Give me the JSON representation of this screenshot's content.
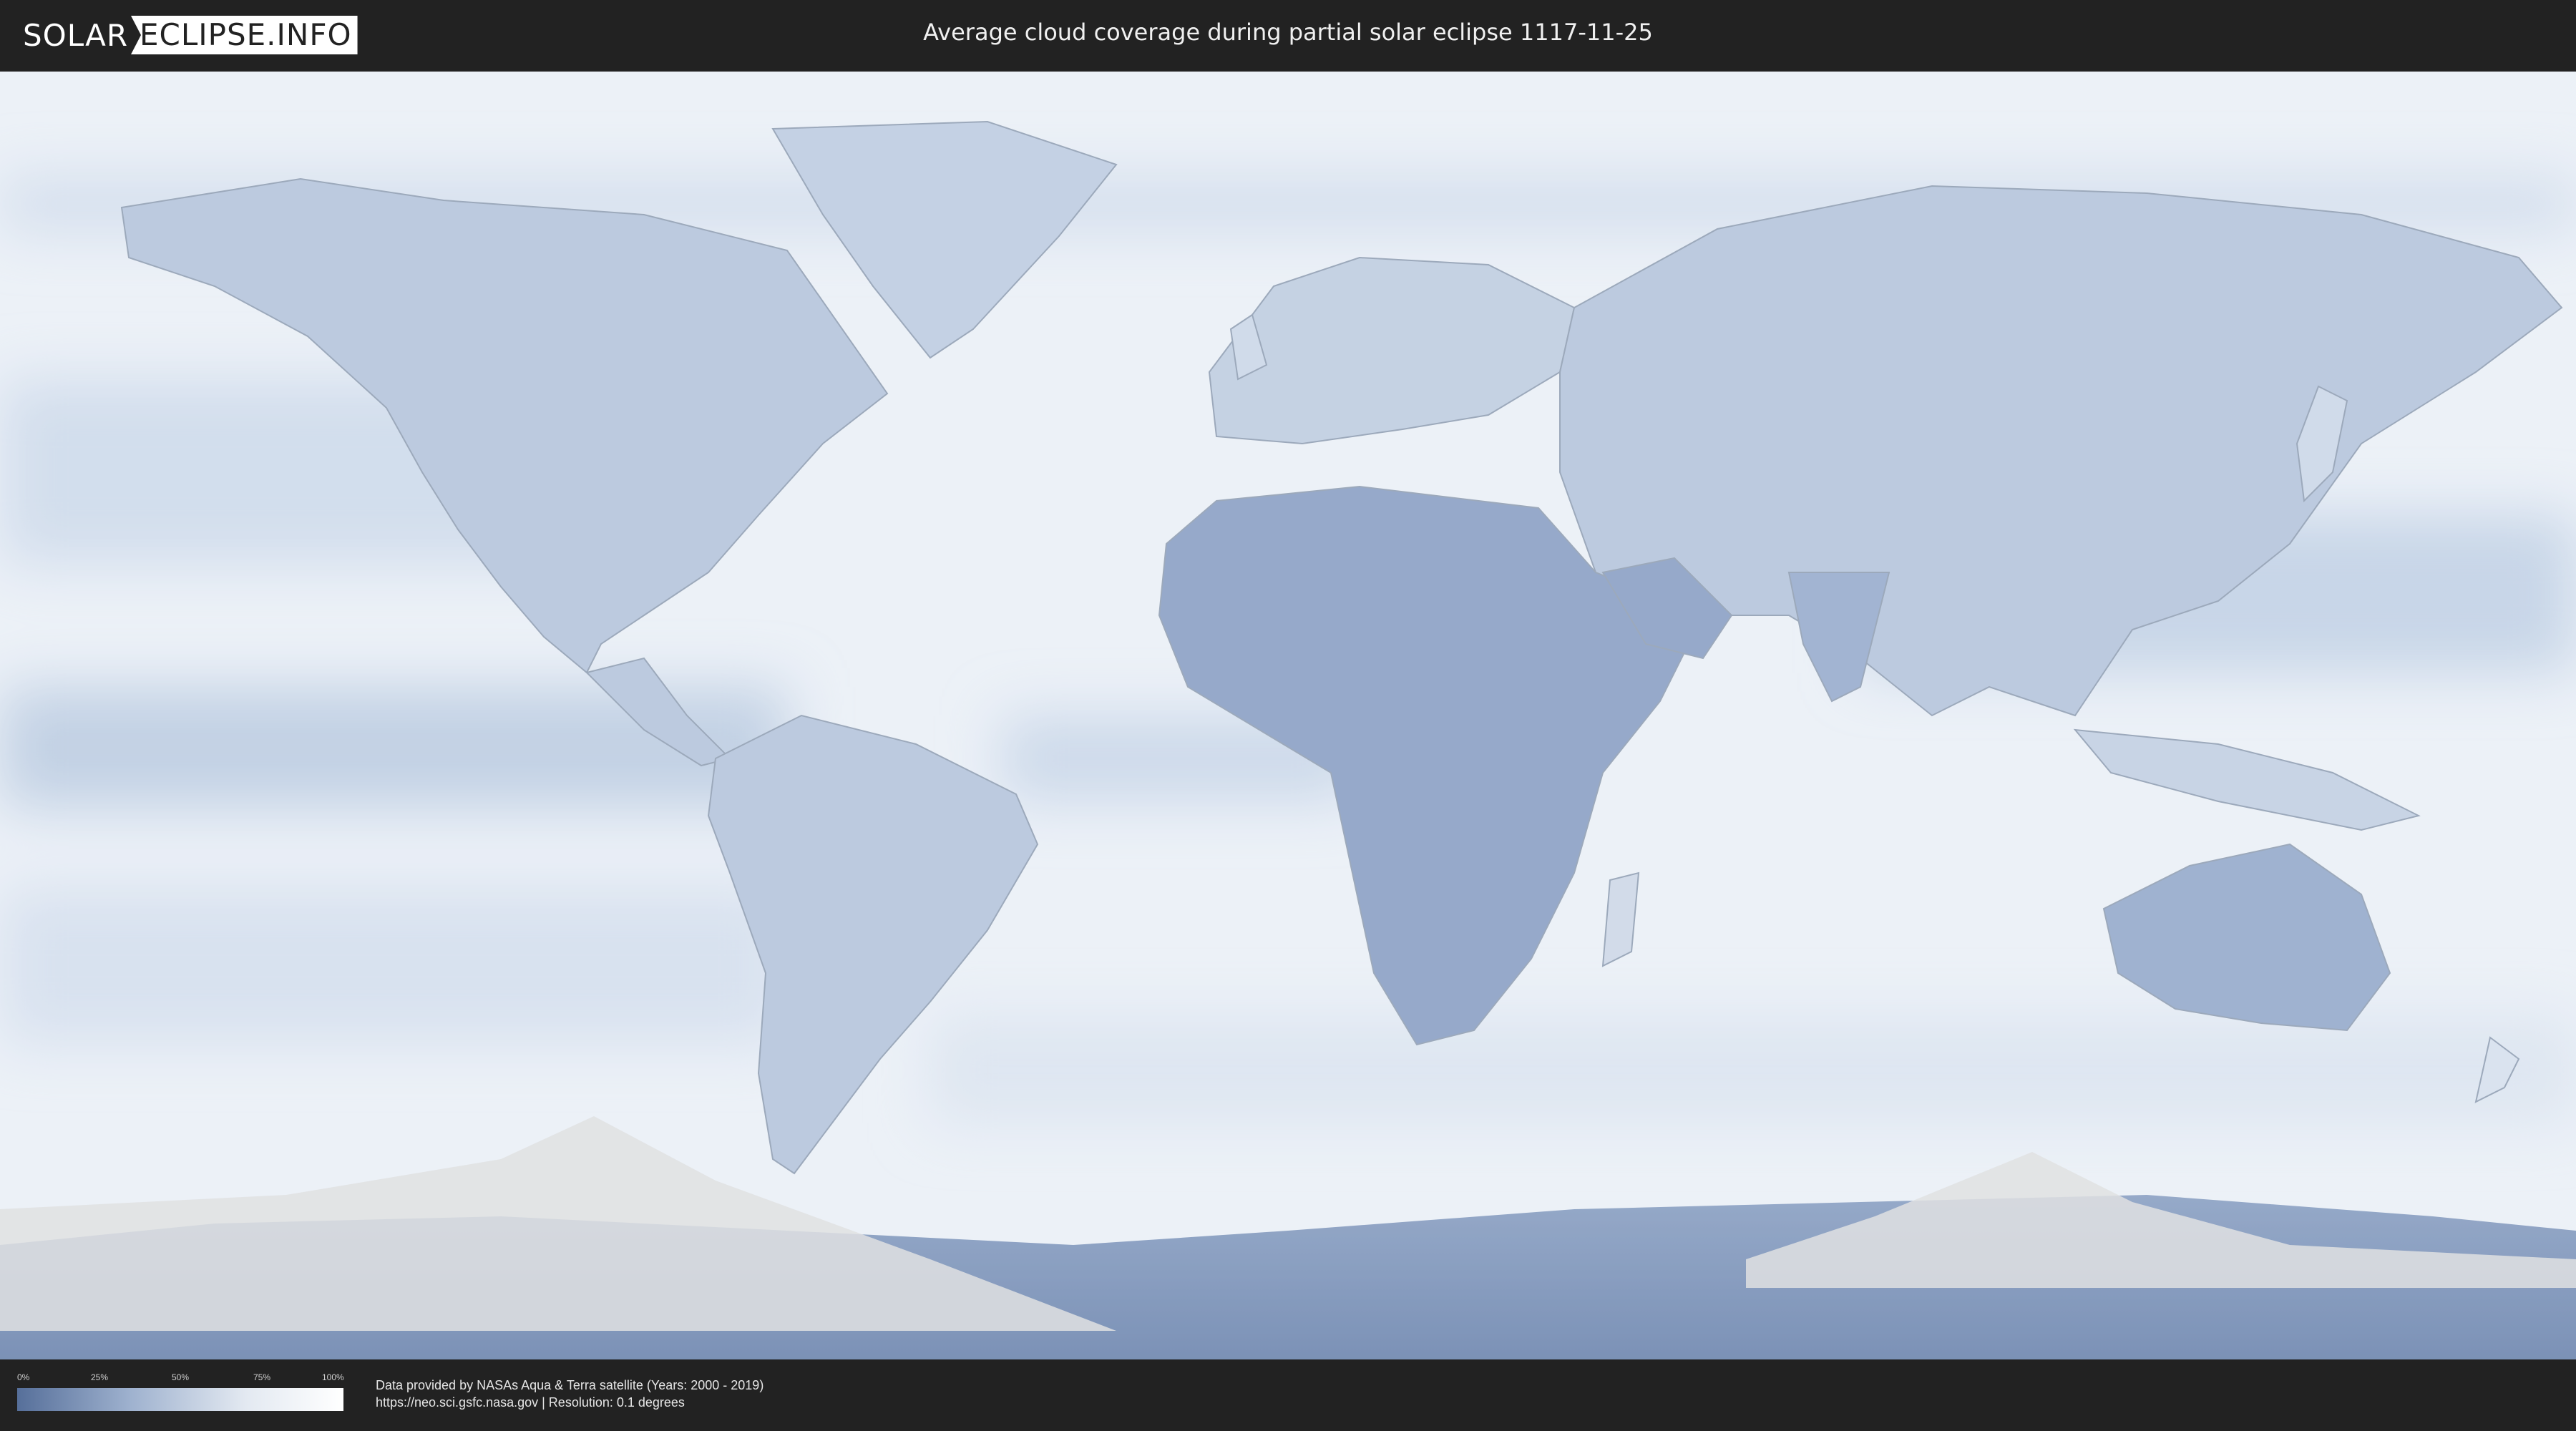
{
  "header": {
    "logo": {
      "left": "SOLAR",
      "right": "ECLIPSE.INFO"
    },
    "title": "Average cloud coverage during partial solar eclipse 1117-11-25"
  },
  "map": {
    "projection": "equirectangular",
    "colors": {
      "ocean_low_cloud": "#5a78a8",
      "cloud_clear_high": "#ffffff",
      "eclipse_overlay": "#d9dadc"
    }
  },
  "legend": {
    "ticks": [
      "0%",
      "25%",
      "50%",
      "75%",
      "100%"
    ],
    "gradient": [
      "#566f9a",
      "#9fb2cf",
      "#e3e9f1",
      "#ffffff"
    ]
  },
  "footer": {
    "credit_line_1": "Data provided by NASAs Aqua & Terra satellite (Years: 2000 - 2019)",
    "credit_line_2": "https://neo.sci.gsfc.nasa.gov | Resolution: 0.1 degrees"
  }
}
